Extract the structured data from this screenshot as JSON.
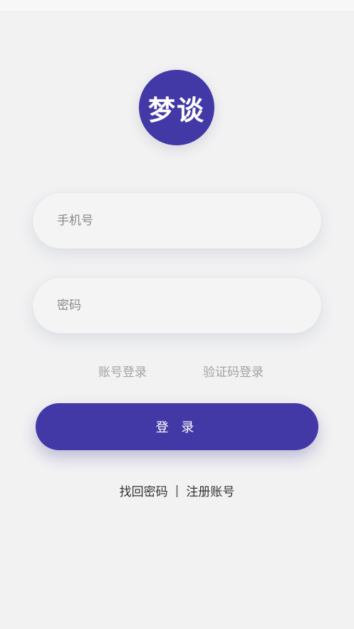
{
  "app": {
    "logo_text": "梦谈"
  },
  "form": {
    "phone_placeholder": "手机号",
    "password_placeholder": "密码",
    "mode_account": "账号登录",
    "mode_code": "验证码登录",
    "login_label": "登 录"
  },
  "links": {
    "forgot_password": "找回密码",
    "separator": "|",
    "register": "注册账号"
  },
  "colors": {
    "brand": "#4339a6",
    "background": "#f2f2f3"
  }
}
